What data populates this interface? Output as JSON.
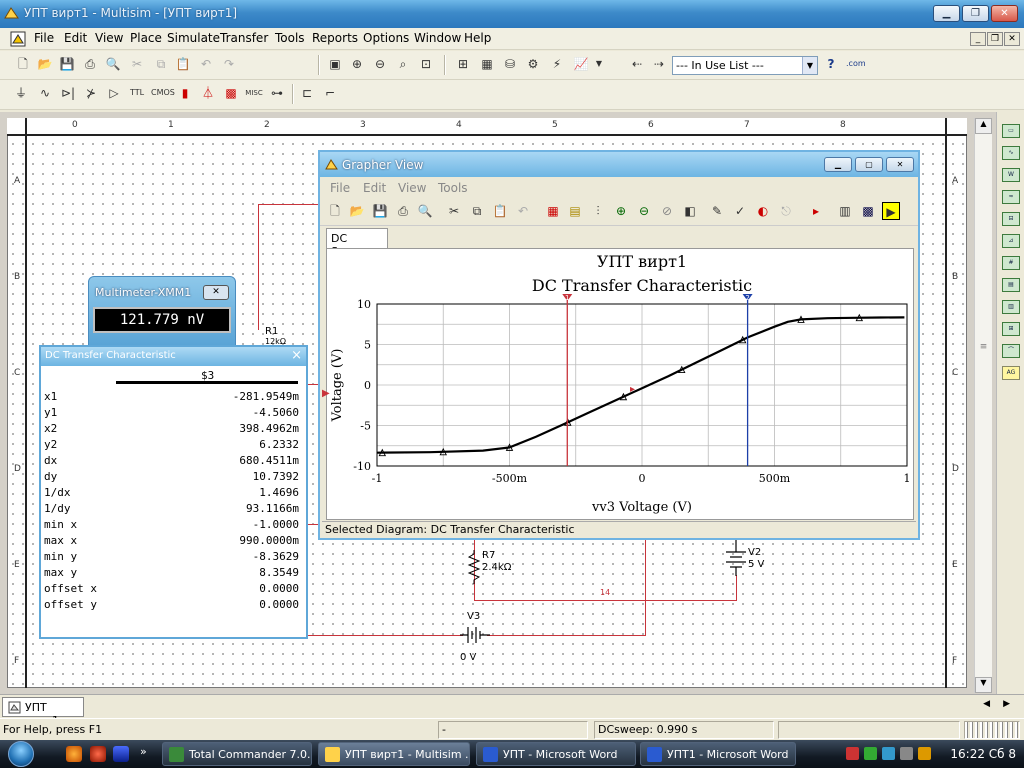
{
  "window": {
    "title": "УПТ вирт1 - Multisim - [УПТ вирт1]"
  },
  "menu": [
    "File",
    "Edit",
    "View",
    "Place",
    "Simulate",
    "Transfer",
    "Tools",
    "Reports",
    "Options",
    "Window",
    "Help"
  ],
  "toolbar": {
    "in_use_list": "--- In Use List ---",
    "misc_label": "MISC",
    "com_label": ".com"
  },
  "ruler": {
    "top": [
      "0",
      "1",
      "2",
      "3",
      "4",
      "5",
      "6",
      "7",
      "8"
    ],
    "side": [
      "A",
      "B",
      "C",
      "D",
      "E",
      "F"
    ]
  },
  "multimeter": {
    "title": "Multimeter-XMM1",
    "reading": "121.779 nV"
  },
  "dc_table": {
    "title": "DC Transfer Characteristic",
    "column": "$3",
    "rows": [
      {
        "k": "x1",
        "v": "-281.9549m"
      },
      {
        "k": "y1",
        "v": "-4.5060"
      },
      {
        "k": "x2",
        "v": "398.4962m"
      },
      {
        "k": "y2",
        "v": "6.2332"
      },
      {
        "k": "dx",
        "v": "680.4511m"
      },
      {
        "k": "dy",
        "v": "10.7392"
      },
      {
        "k": "1/dx",
        "v": "1.4696"
      },
      {
        "k": "1/dy",
        "v": "93.1166m"
      },
      {
        "k": "min x",
        "v": "-1.0000"
      },
      {
        "k": "max x",
        "v": "990.0000m"
      },
      {
        "k": "min y",
        "v": "-8.3629"
      },
      {
        "k": "max y",
        "v": "8.3549"
      },
      {
        "k": "offset x",
        "v": "0.0000"
      },
      {
        "k": "offset y",
        "v": "0.0000"
      }
    ]
  },
  "grapher": {
    "title": "Grapher View",
    "menu": [
      "File",
      "Edit",
      "View",
      "Tools"
    ],
    "tab": "DC Sweep",
    "status": "Selected Diagram:  DC Transfer Characteristic"
  },
  "chart_data": {
    "type": "line",
    "title": "УПТ вирт1",
    "subtitle": "DC Transfer Characteristic",
    "xlabel": "vv3 Voltage (V)",
    "ylabel": "Voltage (V)",
    "xlim": [
      -1,
      1
    ],
    "ylim": [
      -10,
      10
    ],
    "x_ticks": [
      "-1",
      "-500m",
      "0",
      "500m",
      "1"
    ],
    "y_ticks": [
      "10",
      "5",
      "0",
      "-5",
      "-10"
    ],
    "grid": true,
    "series": [
      {
        "color": "#000000",
        "x": [
          -1.0,
          -0.8,
          -0.6,
          -0.5,
          -0.4,
          -0.3,
          -0.2,
          -0.1,
          0.0,
          0.1,
          0.2,
          0.3,
          0.4,
          0.5,
          0.55,
          0.6,
          0.7,
          0.8,
          0.9,
          0.99
        ],
        "y": [
          -8.36,
          -8.3,
          -8.1,
          -7.7,
          -6.4,
          -4.9,
          -3.4,
          -1.9,
          -0.4,
          1.1,
          2.7,
          4.3,
          5.9,
          7.2,
          7.8,
          8.1,
          8.25,
          8.3,
          8.33,
          8.35
        ]
      }
    ],
    "markers_x": [
      -0.98,
      -0.75,
      -0.5,
      -0.28,
      -0.07,
      0.15,
      0.38,
      0.6,
      0.82
    ],
    "cursors": [
      {
        "name": "1",
        "x": -0.2819549,
        "color": "#C8333B"
      },
      {
        "name": "2",
        "x": 0.3984962,
        "color": "#1C3FA8"
      }
    ]
  },
  "schematic": {
    "r1": "R1",
    "r1_value": "12kΩ",
    "r7": "R7",
    "r7_value": "2.4kΩ",
    "v2": "V2",
    "v2_value": "5 V",
    "v3": "V3",
    "v3_value": "0 V",
    "net_label": "14"
  },
  "doc_tab": "УПТ вирт1",
  "status": {
    "help": "For Help, press F1",
    "dash": "-",
    "sweep": "DCsweep: 0.990 s"
  },
  "taskbar": {
    "tasks": [
      "Total Commander 7.0...",
      "УПТ вирт1 - Multisim ...",
      "УПТ - Microsoft Word",
      "УПТ1 - Microsoft Word"
    ],
    "clock": "16:22 Сб 8"
  },
  "colors": {
    "wire": "#C8333B",
    "title_blue": "#2C78BD",
    "cursor_red": "#C8333B",
    "cursor_blue": "#1C3FA8"
  }
}
